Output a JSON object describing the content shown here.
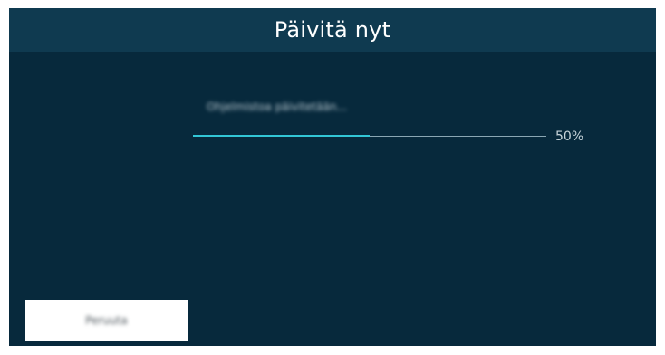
{
  "dialog": {
    "title": "Päivitä nyt",
    "status_text": "Ohjelmistoa päivitetään...",
    "progress": {
      "percent_label": "50%",
      "fraction": 0.5
    },
    "cancel_label": "Peruuta"
  },
  "colors": {
    "background": "#07293c",
    "title_bar": "#0f3a50",
    "progress_fill": "#32c6d6"
  }
}
